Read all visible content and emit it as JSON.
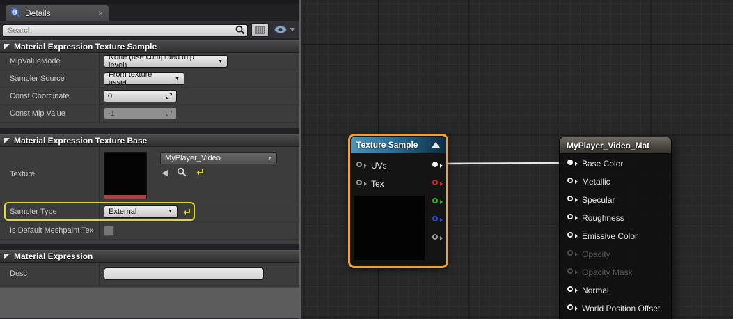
{
  "details_panel": {
    "tab": {
      "label": "Details",
      "icon": "details-info-icon",
      "close_glyph": "×"
    },
    "search": {
      "placeholder": "Search",
      "icons": [
        "search-icon",
        "grid-view-icon",
        "eye-icon"
      ]
    },
    "icons": {
      "dropdown_arrow": "▼",
      "back_arrow": "◀"
    },
    "sections": [
      {
        "title": "Material Expression Texture Sample",
        "rows": [
          {
            "label": "MipValueMode",
            "control": {
              "type": "dropdown",
              "value": "None (use computed mip level)"
            }
          },
          {
            "label": "Sampler Source",
            "control": {
              "type": "dropdown",
              "value": "From texture asset"
            }
          },
          {
            "label": "Const Coordinate",
            "control": {
              "type": "spinbox",
              "value": "0",
              "disabled": false
            }
          },
          {
            "label": "Const Mip Value",
            "control": {
              "type": "spinbox",
              "value": "-1",
              "disabled": true
            }
          }
        ]
      },
      {
        "title": "Material Expression Texture Base",
        "rows": [
          {
            "label": "Texture",
            "control": {
              "type": "asset-picker",
              "value": "MyPlayer_Video",
              "thumbnail": "black-texture-preview",
              "icons": [
                "use-selected-asset-icon",
                "browse-to-asset-icon",
                "reset-to-default-icon"
              ]
            }
          },
          {
            "label": "Sampler Type",
            "control": {
              "type": "dropdown",
              "value": "External",
              "highlighted": true,
              "highlight_color": "#e3da25",
              "reset_icon": "reset-to-default-icon"
            }
          },
          {
            "label": "Is Default Meshpaint Tex",
            "control": {
              "type": "checkbox",
              "checked": false
            }
          }
        ]
      },
      {
        "title": "Material Expression",
        "rows": [
          {
            "label": "Desc",
            "control": {
              "type": "text",
              "value": ""
            }
          }
        ]
      }
    ]
  },
  "graph": {
    "background": "#282828",
    "nodes": [
      {
        "title": "Texture Sample",
        "selected": true,
        "selection_color": "#f0a231",
        "header_color": "#2d6e96",
        "inputs": [
          {
            "label": "UVs"
          },
          {
            "label": "Tex"
          }
        ],
        "outputs": [
          {
            "name": "rgb",
            "color": "#ffffff",
            "connected": true
          },
          {
            "name": "r",
            "color": "#cf2b2b"
          },
          {
            "name": "g",
            "color": "#27bd27"
          },
          {
            "name": "b",
            "color": "#2a50d8"
          },
          {
            "name": "a",
            "color": "#9a9a9a"
          }
        ],
        "preview": "black-texture-preview"
      },
      {
        "title": "MyPlayer_Video_Mat",
        "inputs": [
          {
            "label": "Base Color",
            "connected": true,
            "disabled": false
          },
          {
            "label": "Metallic",
            "disabled": false
          },
          {
            "label": "Specular",
            "disabled": false
          },
          {
            "label": "Roughness",
            "disabled": false
          },
          {
            "label": "Emissive Color",
            "disabled": false
          },
          {
            "label": "Opacity",
            "disabled": true
          },
          {
            "label": "Opacity Mask",
            "disabled": true
          },
          {
            "label": "Normal",
            "disabled": false
          },
          {
            "label": "World Position Offset",
            "disabled": false
          }
        ]
      }
    ],
    "wire": {
      "from": "Texture Sample.rgb",
      "to": "MyPlayer_Video_Mat.Base Color",
      "color": "#e8e8e8"
    }
  }
}
